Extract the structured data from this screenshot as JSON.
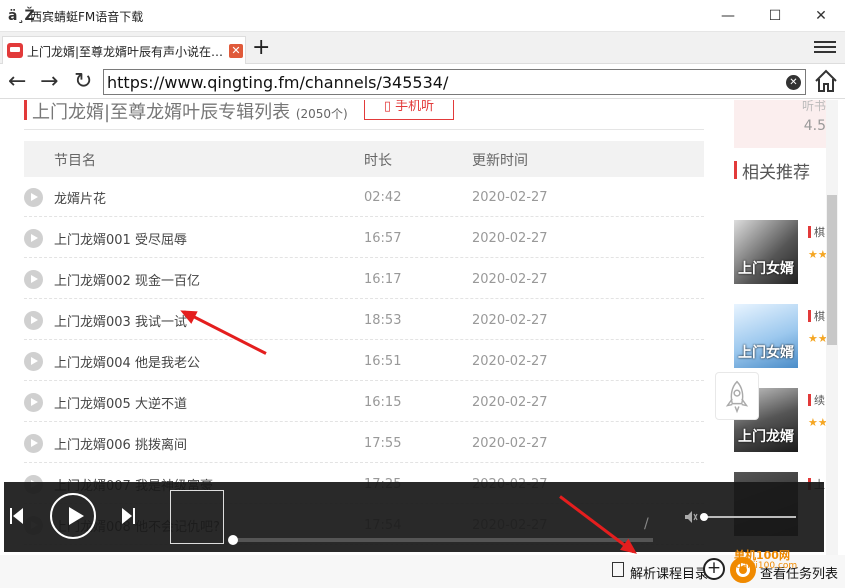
{
  "window": {
    "app_icon": "ä¸Ž",
    "title": "西宾蜻蜓FM语音下载",
    "minimize": "—",
    "maximize": "☐",
    "close": "✕"
  },
  "tabs": [
    {
      "label": "上门龙婿|至尊龙婿叶辰有声小说在…",
      "close": "✕"
    }
  ],
  "toolbar": {
    "new_tab": "+",
    "back": "←",
    "forward": "→",
    "reload": "↻",
    "url": "https://www.qingting.fm/channels/345534/",
    "clear": "✕"
  },
  "album": {
    "title": "上门龙婿|至尊龙婿叶辰专辑列表",
    "count": "(2050个)",
    "phone_listen": "手机听"
  },
  "table": {
    "columns": [
      "节目名",
      "时长",
      "更新时间"
    ],
    "rows": [
      {
        "name": "龙婿片花",
        "duration": "02:42",
        "date": "2020-02-27"
      },
      {
        "name": "上门龙婿001 受尽屈辱",
        "duration": "16:57",
        "date": "2020-02-27"
      },
      {
        "name": "上门龙婿002 现金一百亿",
        "duration": "16:17",
        "date": "2020-02-27"
      },
      {
        "name": "上门龙婿003 我试一试",
        "duration": "18:53",
        "date": "2020-02-27"
      },
      {
        "name": "上门龙婿004 他是我老公",
        "duration": "16:51",
        "date": "2020-02-27"
      },
      {
        "name": "上门龙婿005 大逆不道",
        "duration": "16:15",
        "date": "2020-02-27"
      },
      {
        "name": "上门龙婿006 挑拨离间",
        "duration": "17:55",
        "date": "2020-02-27"
      },
      {
        "name": "上门龙婿007 我是神级富豪",
        "duration": "17:25",
        "date": "2020-02-27"
      },
      {
        "name": "上门龙婿008 他不会记仇吧?",
        "duration": "17:54",
        "date": "2020-02-27"
      }
    ]
  },
  "sidebar": {
    "rating_label": "听书",
    "rating_value": "4.5",
    "recommend_title": "相关推荐",
    "items": [
      {
        "cover_text": "上门女婿",
        "label": "棋",
        "stars": "★★"
      },
      {
        "cover_text": "上门女婿",
        "label": "棋",
        "stars": "★★"
      },
      {
        "cover_text": "上门龙婿",
        "label": "续",
        "stars": "★★"
      },
      {
        "cover_text": "",
        "label": "上",
        "stars": ""
      }
    ]
  },
  "player": {
    "time_separator": "/"
  },
  "bottom": {
    "parse_label": "解析课程目录",
    "task_label": "查看任务列表",
    "watermark": "单机100网",
    "watermark_url": "danji100.com"
  },
  "colors": {
    "accent": "#e23a3a",
    "annotation_arrow": "#e41e1e",
    "watermark": "#f08a00"
  }
}
